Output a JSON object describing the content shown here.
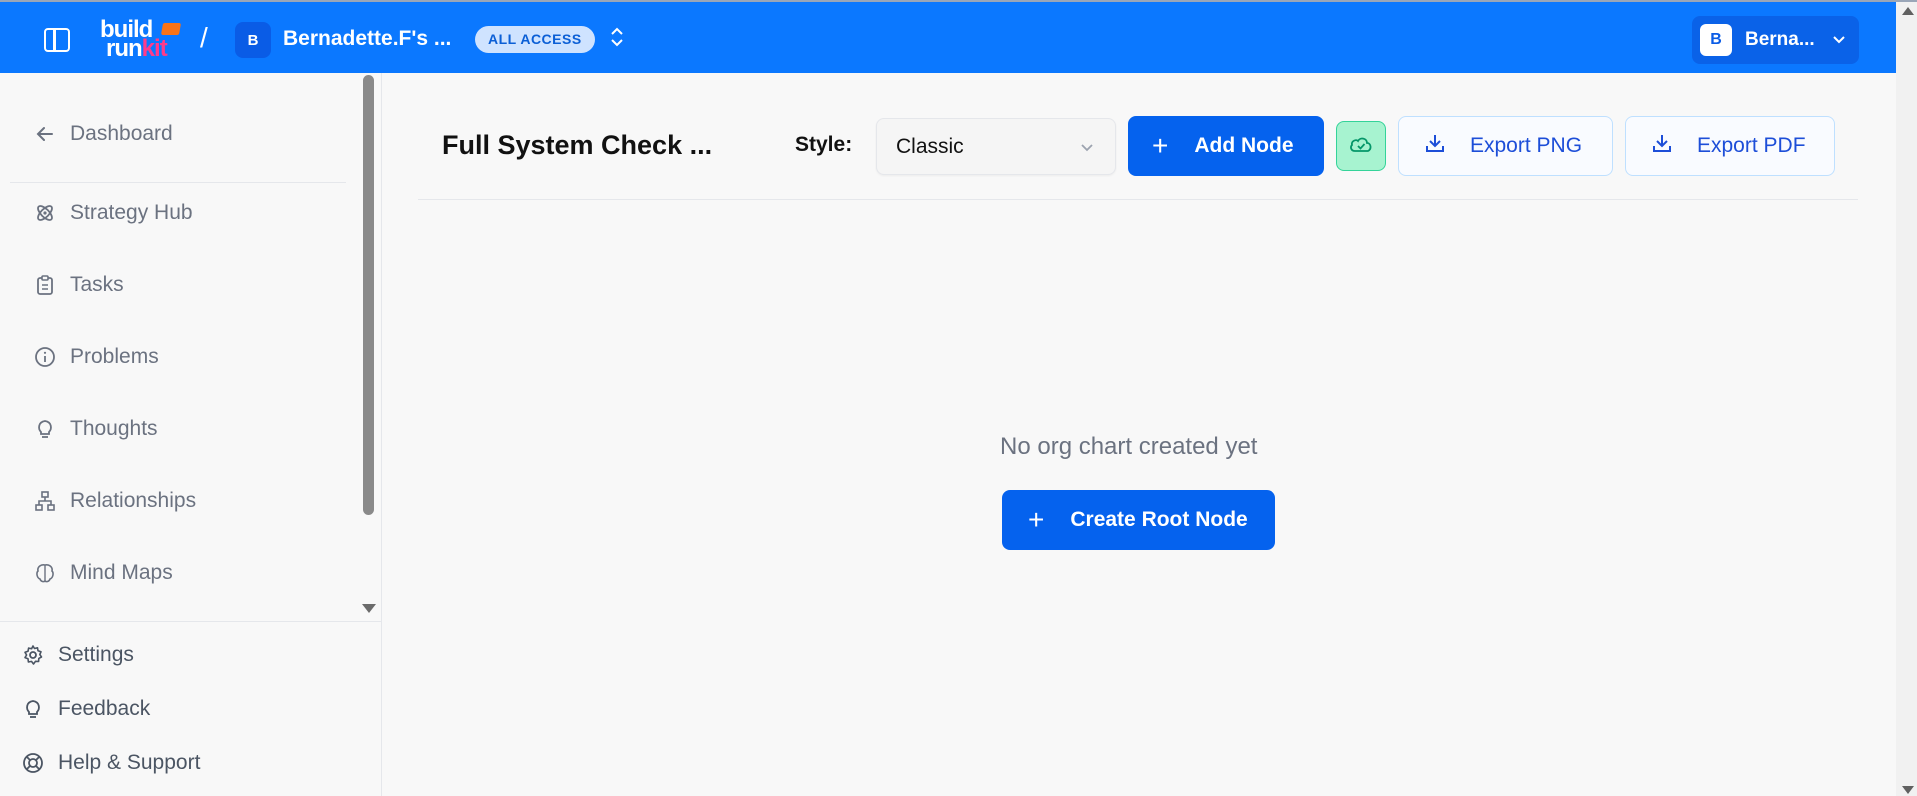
{
  "header": {
    "logo_line1": "build",
    "logo_line2_a": "run",
    "logo_line2_b": "kit",
    "separator": "/",
    "workspace_initial": "B",
    "workspace_name": "Bernadette.F's ...",
    "access_badge": "ALL ACCESS",
    "user_initial": "B",
    "user_name": "Berna...",
    "brand_color": "#0b78ff"
  },
  "sidebar": {
    "back": {
      "label": "Dashboard",
      "icon": "arrow-left-icon"
    },
    "items": [
      {
        "label": "Strategy Hub",
        "icon": "atom-icon"
      },
      {
        "label": "Tasks",
        "icon": "clipboard-icon"
      },
      {
        "label": "Problems",
        "icon": "info-circle-icon"
      },
      {
        "label": "Thoughts",
        "icon": "lightbulb-icon"
      },
      {
        "label": "Relationships",
        "icon": "network-icon"
      },
      {
        "label": "Mind Maps",
        "icon": "brain-icon"
      }
    ],
    "bottom": [
      {
        "label": "Settings",
        "icon": "gear-icon"
      },
      {
        "label": "Feedback",
        "icon": "lightbulb-icon"
      },
      {
        "label": "Help & Support",
        "icon": "lifebuoy-icon"
      }
    ]
  },
  "main": {
    "title": "Full System Check ...",
    "style_label": "Style:",
    "style_value": "Classic",
    "add_node": "Add Node",
    "export_png": "Export PNG",
    "export_pdf": "Export PDF",
    "empty_message": "No org chart created yet",
    "create_root": "Create Root Node"
  }
}
